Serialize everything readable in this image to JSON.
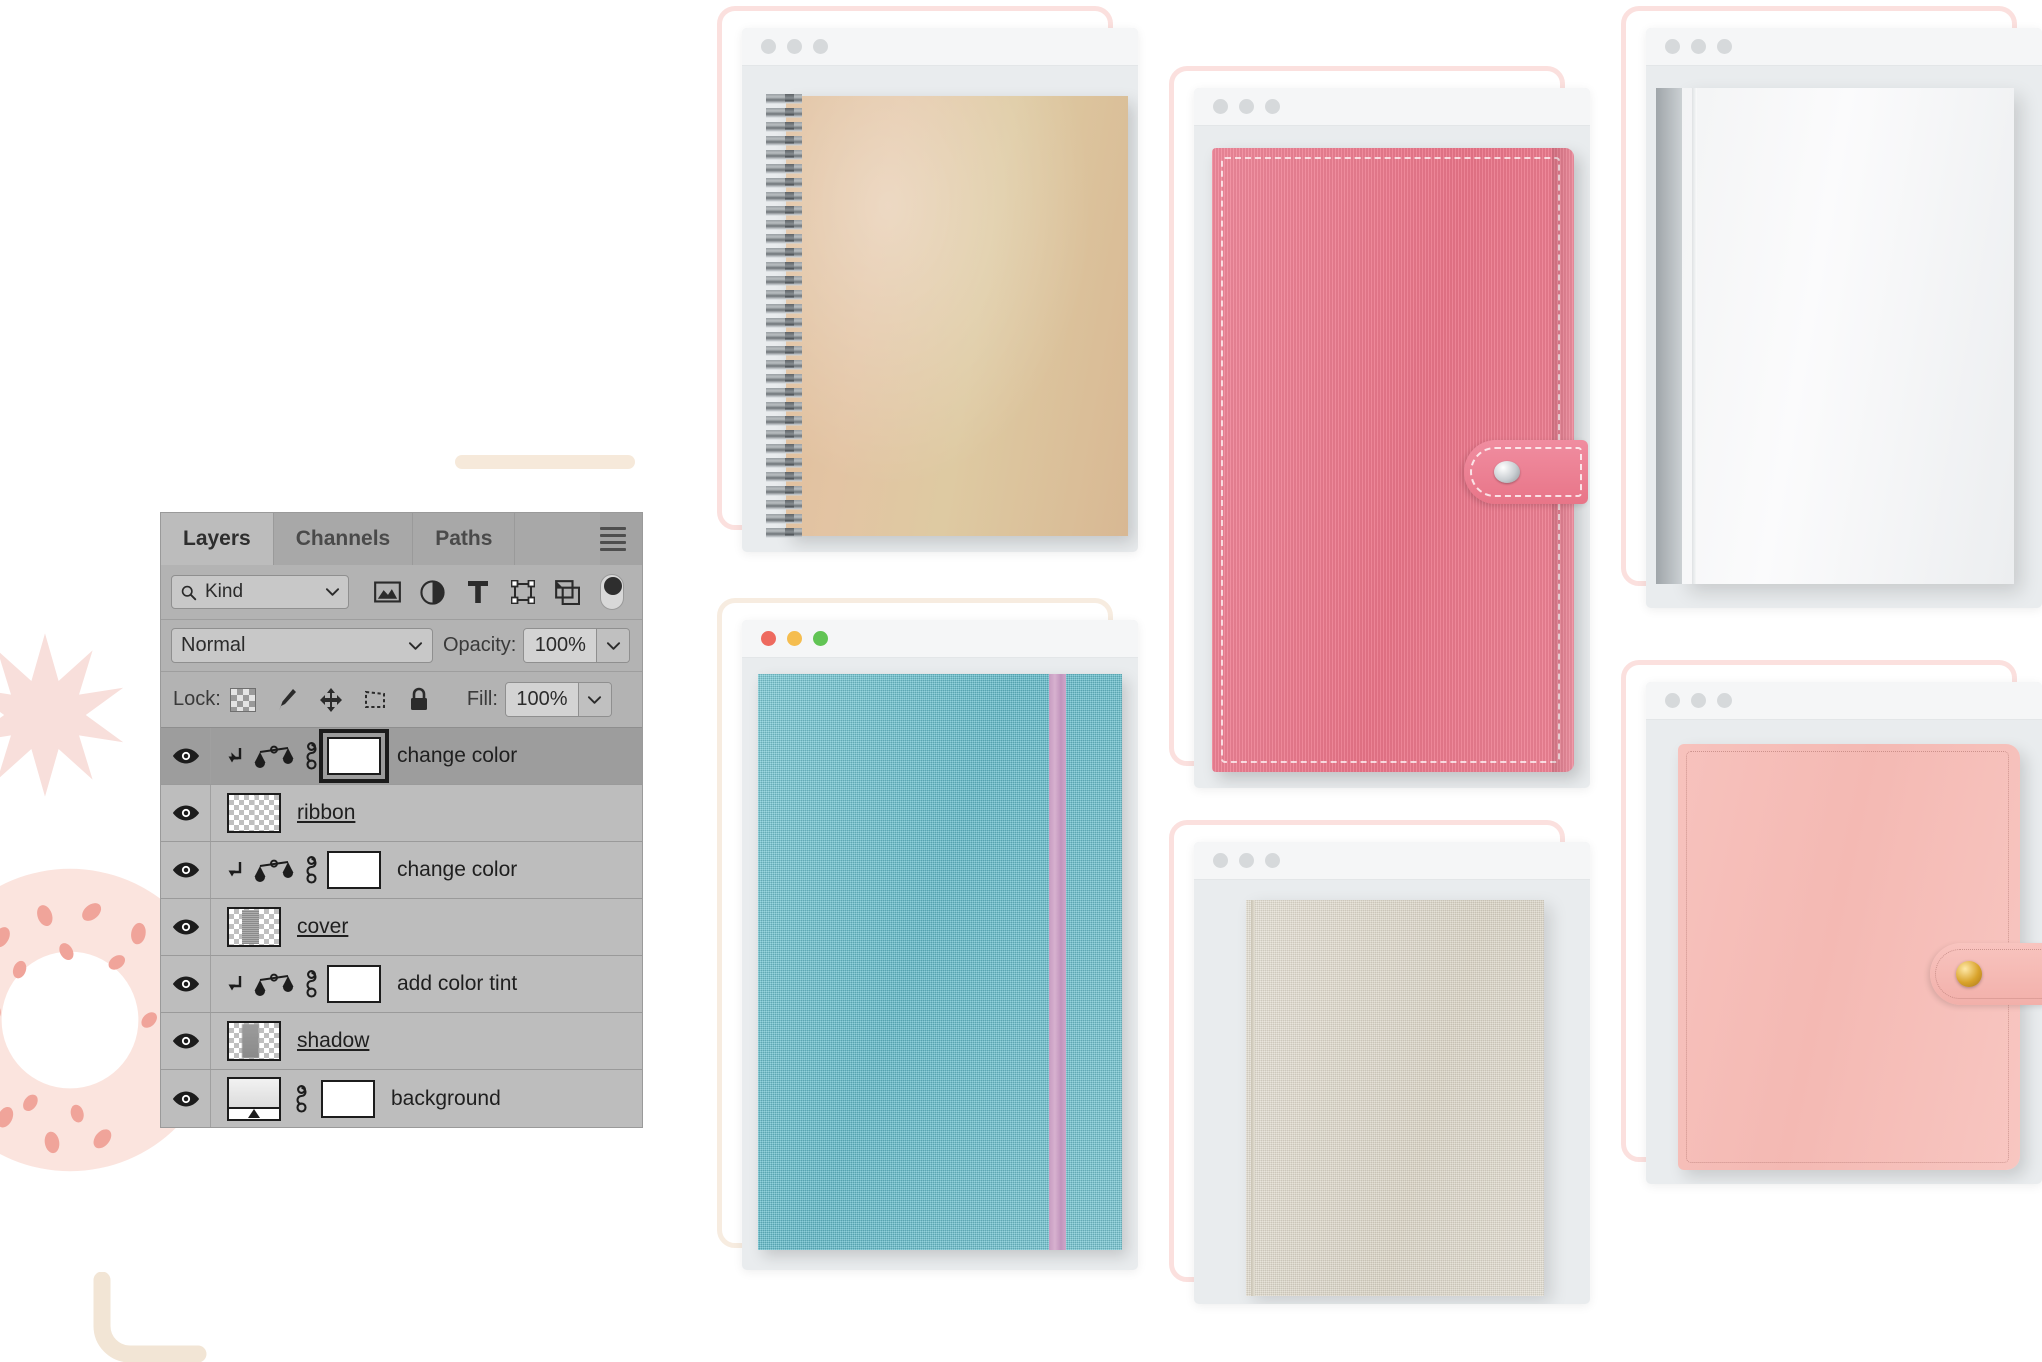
{
  "panel": {
    "tabs": [
      {
        "label": "Layers",
        "active": true
      },
      {
        "label": "Channels",
        "active": false
      },
      {
        "label": "Paths",
        "active": false
      }
    ],
    "menu_icon": "hamburger-menu-icon",
    "filter_row": {
      "search_icon": "search-icon",
      "kind_value": "Kind",
      "caret_icon": "chevron-down-icon",
      "icons": [
        "pixel-layer-filter-icon",
        "adjustment-layer-filter-icon",
        "type-layer-filter-icon",
        "shape-layer-filter-icon",
        "smart-object-filter-icon"
      ],
      "toggle_icon": "filter-enable-toggle"
    },
    "blend_row": {
      "blend_mode": "Normal",
      "caret_icon": "chevron-down-icon",
      "opacity_label": "Opacity:",
      "opacity_value": "100%",
      "opacity_stepper_icon": "chevron-down-icon"
    },
    "lock_row": {
      "lock_label": "Lock:",
      "icons": [
        "lock-transparent-pixels-icon",
        "lock-image-pixels-icon",
        "lock-position-icon",
        "lock-artboard-nesting-icon",
        "lock-all-icon"
      ],
      "fill_label": "Fill:",
      "fill_value": "100%",
      "fill_stepper_icon": "chevron-down-icon"
    },
    "layers": [
      {
        "name": "change color",
        "type": "adjustment",
        "visible": true,
        "selected": true,
        "clipped": true,
        "linked": true,
        "underlined": false,
        "mask_focused": true
      },
      {
        "name": "ribbon",
        "type": "pixel",
        "thumb": "ribbon",
        "visible": true,
        "selected": false,
        "clipped": false,
        "linked": false,
        "underlined": true,
        "mask_focused": false
      },
      {
        "name": "change color",
        "type": "adjustment",
        "visible": true,
        "selected": false,
        "clipped": true,
        "linked": true,
        "underlined": false,
        "mask_focused": false
      },
      {
        "name": "cover",
        "type": "pixel",
        "thumb": "cover",
        "visible": true,
        "selected": false,
        "clipped": false,
        "linked": false,
        "underlined": true,
        "mask_focused": false
      },
      {
        "name": "add color tint",
        "type": "adjustment",
        "visible": true,
        "selected": false,
        "clipped": true,
        "linked": true,
        "underlined": false,
        "mask_focused": false
      },
      {
        "name": "shadow",
        "type": "pixel",
        "thumb": "shadow",
        "visible": true,
        "selected": false,
        "clipped": false,
        "linked": false,
        "underlined": true,
        "mask_focused": false
      },
      {
        "name": "background",
        "type": "background",
        "thumb": "background",
        "visible": true,
        "selected": false,
        "clipped": false,
        "linked": true,
        "underlined": false,
        "mask_focused": false
      }
    ]
  },
  "mockups": [
    {
      "id": "kraft-spiral-notebook",
      "product": "kraft spiral notebook",
      "dots": [
        "grey",
        "grey",
        "grey"
      ],
      "outline_color": "#fbe0de"
    },
    {
      "id": "teal-fabric-notebook",
      "product": "teal fabric notebook with pink elastic band",
      "dots": [
        "red",
        "yellow",
        "green"
      ],
      "outline_color": "#f7ece0"
    },
    {
      "id": "pink-canvas-planner",
      "product": "pink canvas planner with silver snap",
      "dots": [
        "grey",
        "grey",
        "grey"
      ],
      "outline_color": "#fbe0de"
    },
    {
      "id": "linen-hardcover-book",
      "product": "beige linen hardcover book",
      "dots": [
        "grey",
        "grey",
        "grey"
      ],
      "outline_color": "#fbe0de"
    },
    {
      "id": "white-hardcover-book",
      "product": "white hardcover book",
      "dots": [
        "grey",
        "grey",
        "grey"
      ],
      "outline_color": "#fbe0de"
    },
    {
      "id": "blush-leather-planner",
      "product": "blush leather planner with gold snap",
      "dots": [
        "grey",
        "grey",
        "grey"
      ],
      "outline_color": "#fbe0de"
    }
  ],
  "decor": {
    "star": "pink-star-burst",
    "donut": "pink-dotted-donut",
    "pill": "cream-pill-bar",
    "corner": "cream-corner-bracket",
    "star_color": "#f7ddd9",
    "donut_color": "#fbe4de",
    "donut_dot_color": "#f0a49a",
    "cream_color": "#f2e5d5"
  }
}
